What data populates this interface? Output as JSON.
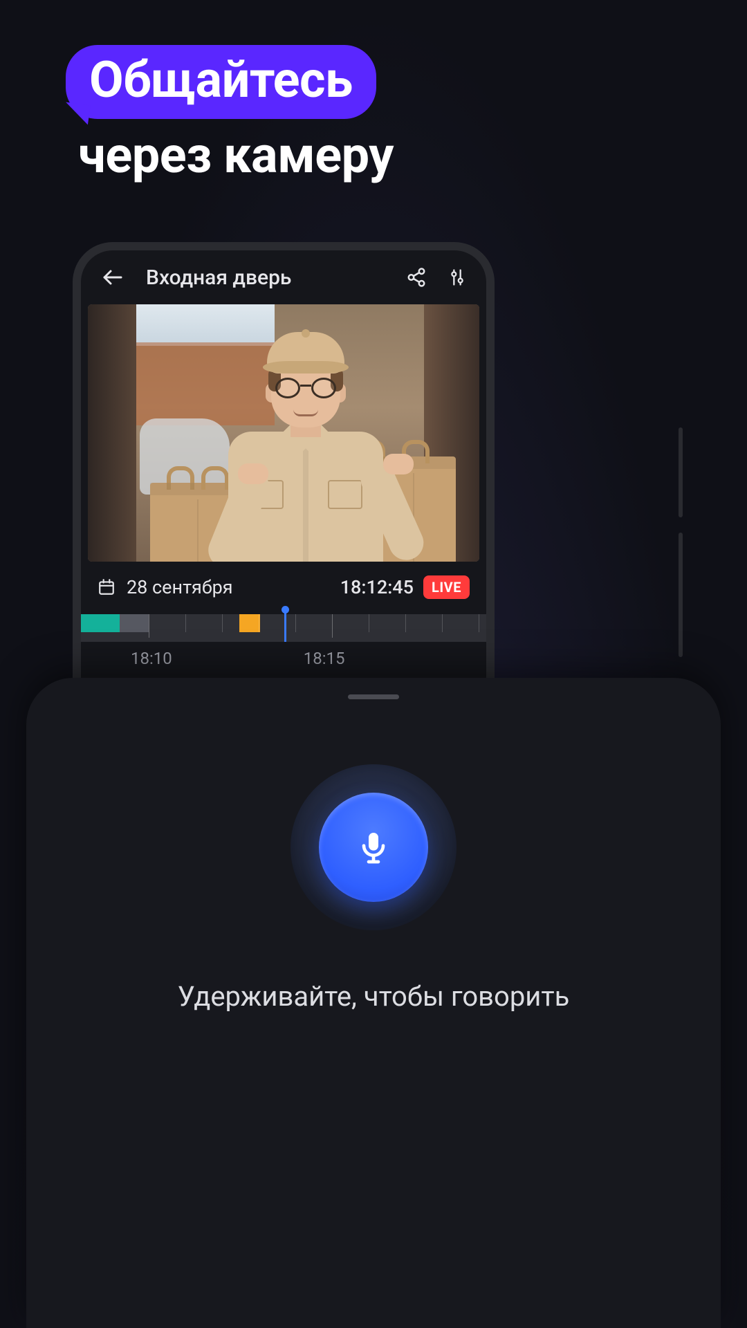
{
  "headline": {
    "pill": "Общайтесь",
    "sub": "через камеру"
  },
  "appbar": {
    "title": "Входная дверь"
  },
  "info": {
    "date": "28 сентября",
    "time": "18:12:45",
    "live": "LIVE"
  },
  "timeline": {
    "labels": {
      "t1": "18:10",
      "t2": "18:15"
    }
  },
  "sheet": {
    "hold": "Удерживайте, чтобы говорить"
  }
}
